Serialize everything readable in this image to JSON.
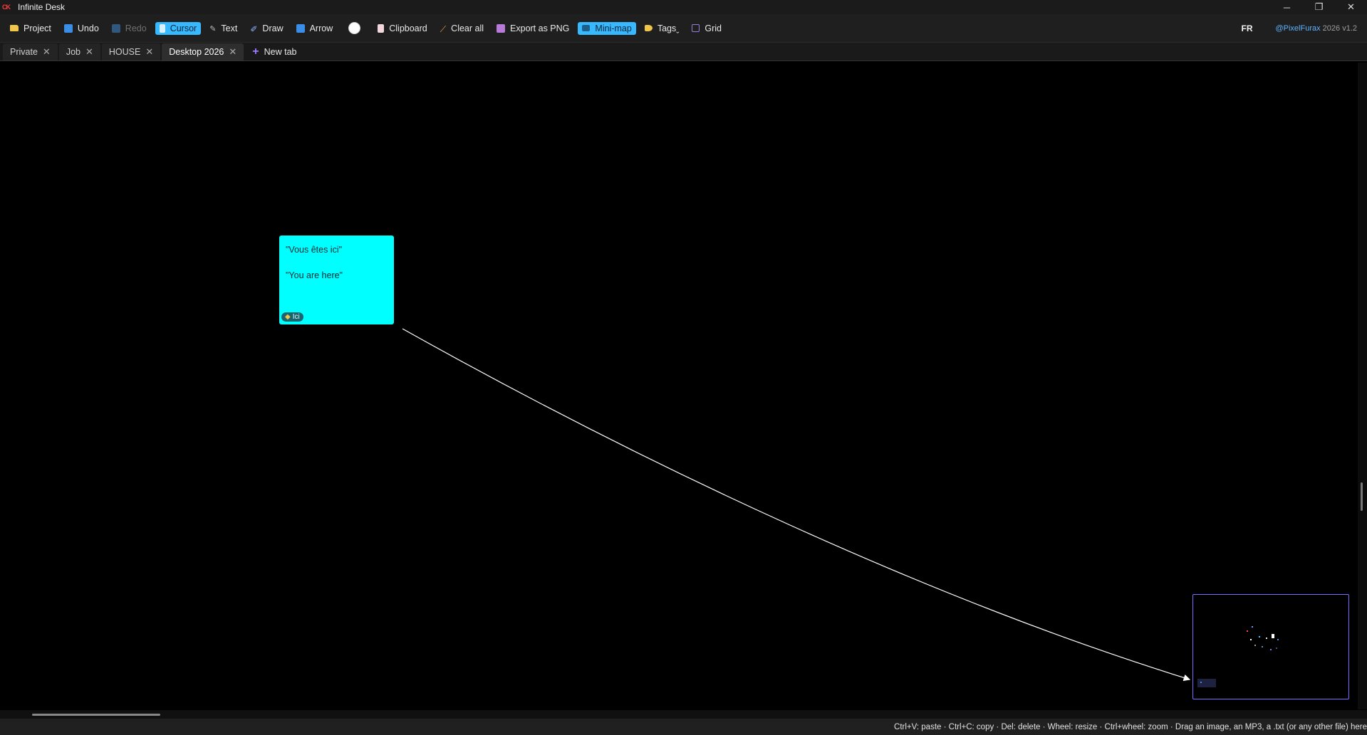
{
  "window": {
    "logo": "CK",
    "title": "Infinite Desk",
    "minimize": "─",
    "maximize": "❐",
    "close": "✕"
  },
  "toolbar": {
    "project": "Project",
    "undo": "Undo",
    "redo": "Redo",
    "cursor": "Cursor",
    "text": "Text",
    "draw": "Draw",
    "arrow": "Arrow",
    "clipboard": "Clipboard",
    "clear_all": "Clear all",
    "export": "Export as PNG",
    "minimap": "Mini-map",
    "tags": "Tagsˬ",
    "grid": "Grid",
    "language": "FR",
    "credit": "@PixelFurax",
    "version": " 2026 v1.2",
    "current_color": "#ffffff"
  },
  "tabs": [
    {
      "label": "Private"
    },
    {
      "label": "Job"
    },
    {
      "label": "HOUSE"
    },
    {
      "label": "Desktop 2026",
      "active": true
    }
  ],
  "new_tab_label": "New tab",
  "note": {
    "line1": "\"Vous êtes ici\"",
    "line2": "\"You are here\"",
    "tag": "Ici",
    "color": "#00ffff"
  },
  "status": {
    "hints": "Ctrl+V: paste  ·  Ctrl+C: copy  ·  Del: delete  ·  Wheel: resize  ·  Ctrl+wheel: zoom  ·  Drag an image, an MP3, a .txt (or any other file) here"
  },
  "colors": {
    "accent": "#38b8ff",
    "minimap_border": "#7b6cff"
  }
}
